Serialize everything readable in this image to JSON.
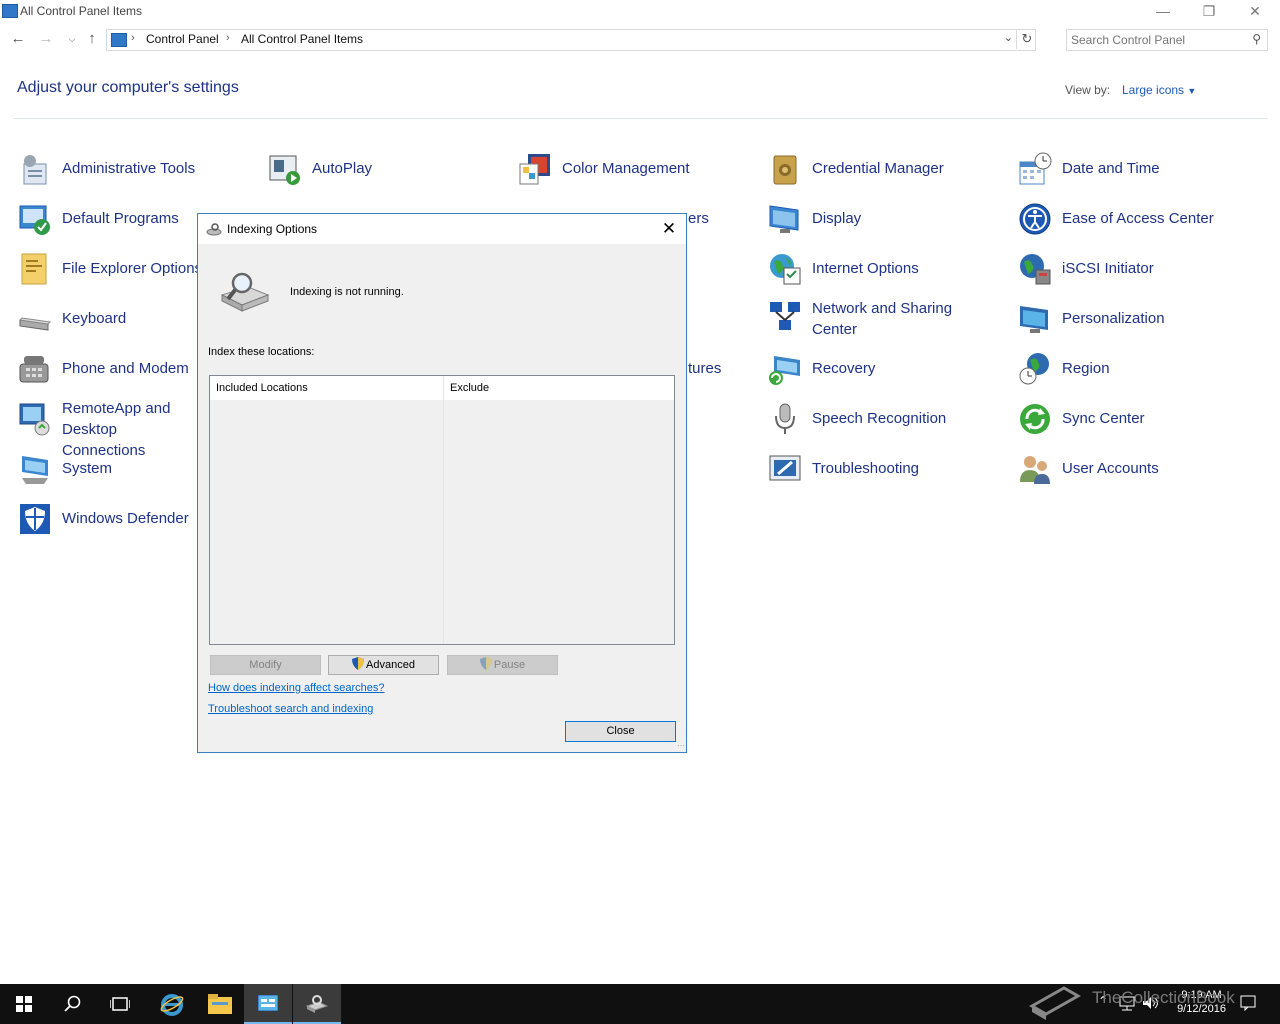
{
  "window": {
    "title": "All Control Panel Items"
  },
  "nav": {
    "breadcrumb": [
      "Control Panel",
      "All Control Panel Items"
    ],
    "search_placeholder": "Search Control Panel"
  },
  "header": {
    "heading": "Adjust your computer's settings",
    "view_by_label": "View by:",
    "view_by_value": "Large icons"
  },
  "items": [
    {
      "label": "Administrative Tools",
      "icon": "admin-tools-icon",
      "color": "#7a8ea8"
    },
    {
      "label": "AutoPlay",
      "icon": "autoplay-icon",
      "color": "#3a9a3a"
    },
    {
      "label": "Color Management",
      "icon": "color-management-icon",
      "color": "#d7452e"
    },
    {
      "label": "Credential Manager",
      "icon": "credential-manager-icon",
      "color": "#b08a3a"
    },
    {
      "label": "Date and Time",
      "icon": "date-time-icon",
      "color": "#4a86c8"
    },
    {
      "label": "Default Programs",
      "icon": "default-programs-icon",
      "color": "#2e9a4a"
    },
    {
      "label": "Display",
      "icon": "display-icon",
      "color": "#3a86d0"
    },
    {
      "label": "Ease of Access Center",
      "icon": "ease-of-access-icon",
      "color": "#1e5ab4"
    },
    {
      "label": "File Explorer Options",
      "icon": "file-explorer-options-icon",
      "color": "#e8c052"
    },
    {
      "label": "Internet Options",
      "icon": "internet-options-icon",
      "color": "#2e8a4a"
    },
    {
      "label": "iSCSI Initiator",
      "icon": "iscsi-icon",
      "color": "#2e6ab0"
    },
    {
      "label": "Keyboard",
      "icon": "keyboard-icon",
      "color": "#888888"
    },
    {
      "label": "Network and Sharing Center",
      "icon": "network-sharing-icon",
      "color": "#1e5ab4"
    },
    {
      "label": "Personalization",
      "icon": "personalization-icon",
      "color": "#2e9ad0"
    },
    {
      "label": "Phone and Modem",
      "icon": "phone-modem-icon",
      "color": "#777777"
    },
    {
      "label": "Recovery",
      "icon": "recovery-icon",
      "color": "#3a86c8"
    },
    {
      "label": "Region",
      "icon": "region-icon",
      "color": "#2e6ab0"
    },
    {
      "label": "RemoteApp and Desktop Connections",
      "icon": "remoteapp-icon",
      "color": "#2e6ab0"
    },
    {
      "label": "Speech Recognition",
      "icon": "microphone-icon",
      "color": "#888888"
    },
    {
      "label": "Sync Center",
      "icon": "sync-center-icon",
      "color": "#3aa83a"
    },
    {
      "label": "System",
      "icon": "system-icon",
      "color": "#3a86d0"
    },
    {
      "label": "Troubleshooting",
      "icon": "troubleshooting-icon",
      "color": "#2e6ab0"
    },
    {
      "label": "User Accounts",
      "icon": "user-accounts-icon",
      "color": "#7a9a5a"
    },
    {
      "label": "Windows Defender",
      "icon": "windows-defender-icon",
      "color": "#1e5ab4"
    },
    {
      "label": "ers",
      "icon": "",
      "color": ""
    },
    {
      "label": "tures",
      "icon": "",
      "color": ""
    }
  ],
  "dialog": {
    "title": "Indexing Options",
    "status": "Indexing is not running.",
    "index_label": "Index these locations:",
    "columns": [
      "Included Locations",
      "Exclude"
    ],
    "buttons": {
      "modify": "Modify",
      "advanced": "Advanced",
      "pause": "Pause",
      "close": "Close"
    },
    "links": [
      "How does indexing affect searches?",
      "Troubleshoot search and indexing"
    ]
  },
  "taskbar": {
    "time": "9:19 AM",
    "date": "9/12/2016"
  },
  "watermark": "TheCollectionBook"
}
